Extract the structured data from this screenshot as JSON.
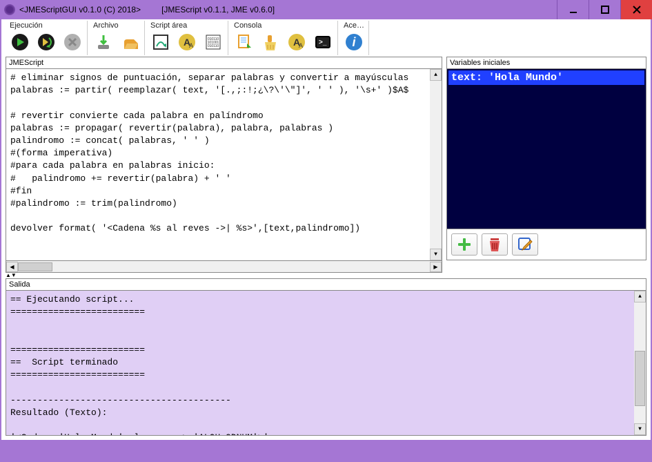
{
  "title": {
    "app": "<JMEScriptGUI v0.1.0  (C) 2018>",
    "doc": "[JMEScript v0.1.1, JME v0.6.0]"
  },
  "toolbar": {
    "ejecucion": "Ejecución",
    "archivo": "Archivo",
    "script_area": "Script área",
    "consola": "Consola",
    "ace": "Ace…"
  },
  "panels": {
    "jmescript": "JMEScript",
    "variables": "Variables iniciales",
    "salida": "Salida"
  },
  "code": "# eliminar signos de puntuación, separar palabras y convertir a mayúsculas\npalabras := partir( reemplazar( text, '[.,;:!;¿\\?\\'\\\"]', ' ' ), '\\s+' )$A$\n\n# revertir convierte cada palabra en palíndromo\npalabras := propagar( revertir(palabra), palabra, palabras )\npalindromo := concat( palabras, ' ' )\n#(forma imperativa)\n#para cada palabra en palabras inicio:\n#   palindromo += revertir(palabra) + ' '\n#fin\n#palindromo := trim(palindromo)\n\ndevolver format( '<Cadena %s al reves ->| %s>',[text,palindromo])",
  "variables": {
    "line1": "text: 'Hola Mundo'"
  },
  "output": "== Ejecutando script...\n=========================\n\n\n=========================\n==  Script terminado\n=========================\n\n-----------------------------------------\nResultado (Texto):\n\n'<Cadena 'Hola Mundo' al reves -> 'ALOH ODNUM'>'\n-----------------------------------------"
}
